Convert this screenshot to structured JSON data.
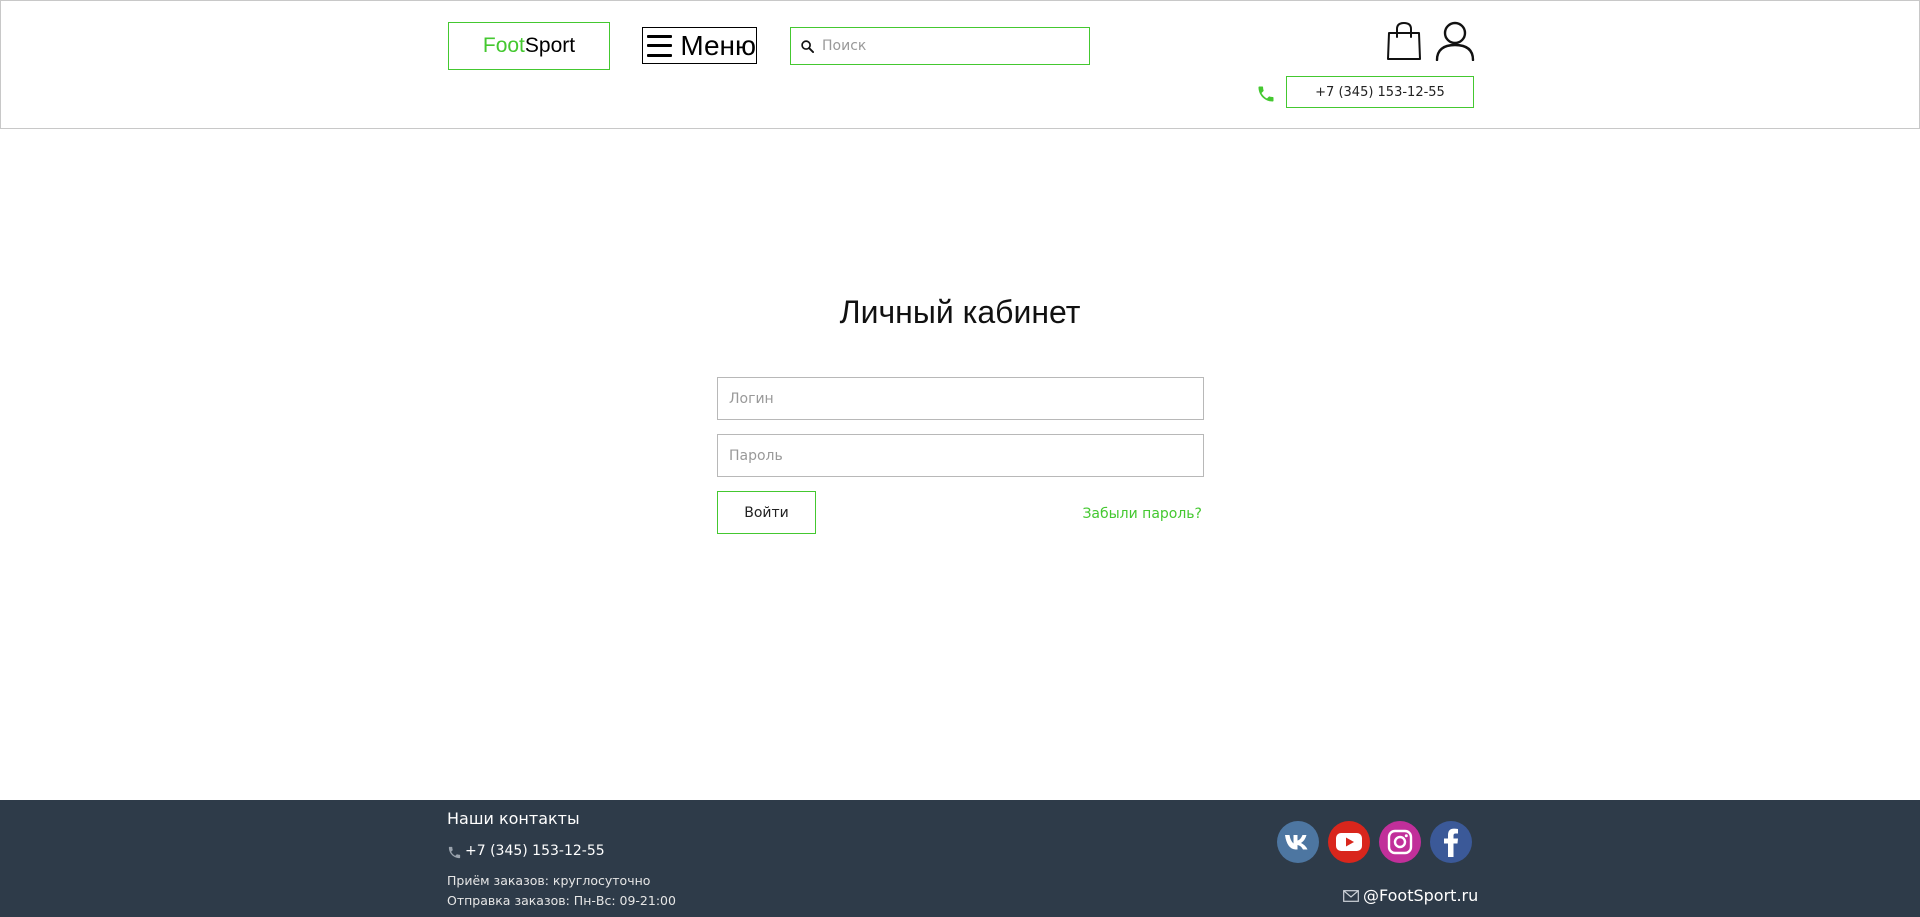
{
  "header": {
    "logo": {
      "part1": "Foot",
      "part2": "Sport"
    },
    "menu_label": "Меню",
    "search_placeholder": "Поиск",
    "phone": "+7 (345) 153-12-55"
  },
  "main": {
    "title": "Личный кабинет",
    "login_placeholder": "Логин",
    "password_placeholder": "Пароль",
    "submit_label": "Войти",
    "forgot_label": "Забыли пароль?"
  },
  "footer": {
    "title": "Наши контакты",
    "phone": "+7 (345) 153-12-55",
    "orders_line": "Приём заказов: круглосуточно",
    "shipping_line": "Отправка заказов: Пн-Вс: 09-21:00",
    "email": "@FootSport.ru",
    "social": [
      "vk-icon",
      "youtube-icon",
      "instagram-icon",
      "facebook-icon"
    ]
  },
  "colors": {
    "accent": "#44c830",
    "footer_bg": "#2e3b49",
    "vk": "#4d76a1",
    "youtube": "#d9261c",
    "instagram": "#c12f9a",
    "facebook": "#3b5998"
  }
}
